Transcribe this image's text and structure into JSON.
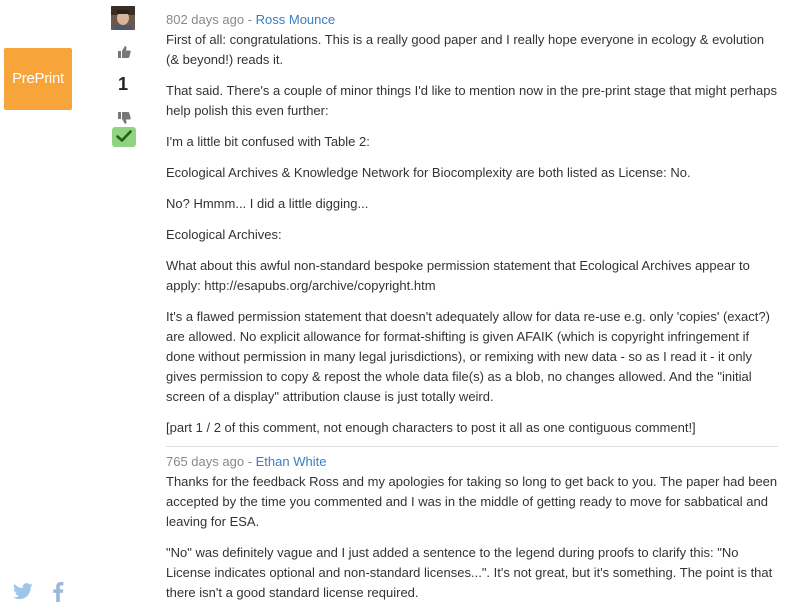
{
  "badge": {
    "label": "PrePrint",
    "color": "#f7a43b"
  },
  "votes": {
    "count": "1"
  },
  "comments": [
    {
      "age": "802 days ago",
      "separator": " - ",
      "author": "Ross Mounce",
      "paragraphs": [
        "First of all: congratulations. This is a really good paper and I really hope everyone in ecology & evolution (& beyond!) reads it.",
        "That said. There's a couple of minor things I'd like to mention now in the pre-print stage that might perhaps help polish this even further:",
        "I'm a little bit confused with Table 2:",
        "Ecological Archives & Knowledge Network for Biocomplexity are both listed as License: No.",
        "No? Hmmm... I did a little digging...",
        "Ecological Archives:",
        "What about this awful non-standard bespoke permission statement that Ecological Archives appear to apply: http://esapubs.org/archive/copyright.htm",
        "It's a flawed permission statement that doesn't adequately allow for data re-use e.g. only 'copies' (exact?) are allowed. No explicit allowance for format-shifting is given AFAIK (which is copyright infringement if done without permission in many legal jurisdictions), or remixing with new data - so as I read it - it only gives permission to copy & repost the whole data file(s) as a blob, no changes allowed. And the \"initial screen of a display\" attribution clause is just totally weird.",
        "[part 1 / 2 of this comment, not enough characters to post it all as one contiguous comment!]"
      ]
    },
    {
      "age": "765 days ago",
      "separator": " - ",
      "author": "Ethan White",
      "paragraphs": [
        "Thanks for the feedback Ross and my apologies for taking so long to get back to you. The paper had been accepted by the time you commented and I was in the middle of getting ready to move for sabbatical and leaving for ESA.",
        "\"No\" was definitely vague and I just added a sentence to the legend during proofs to clarify this: \"No License indicates optional and non-standard licenses...\". It's not great, but it's something. The point is that there isn't a good standard license required."
      ]
    }
  ],
  "share": {
    "twitter": "twitter-icon",
    "facebook": "facebook-icon",
    "colors": {
      "twitter": "#9cc6ea",
      "facebook": "#9cb7dd"
    }
  }
}
